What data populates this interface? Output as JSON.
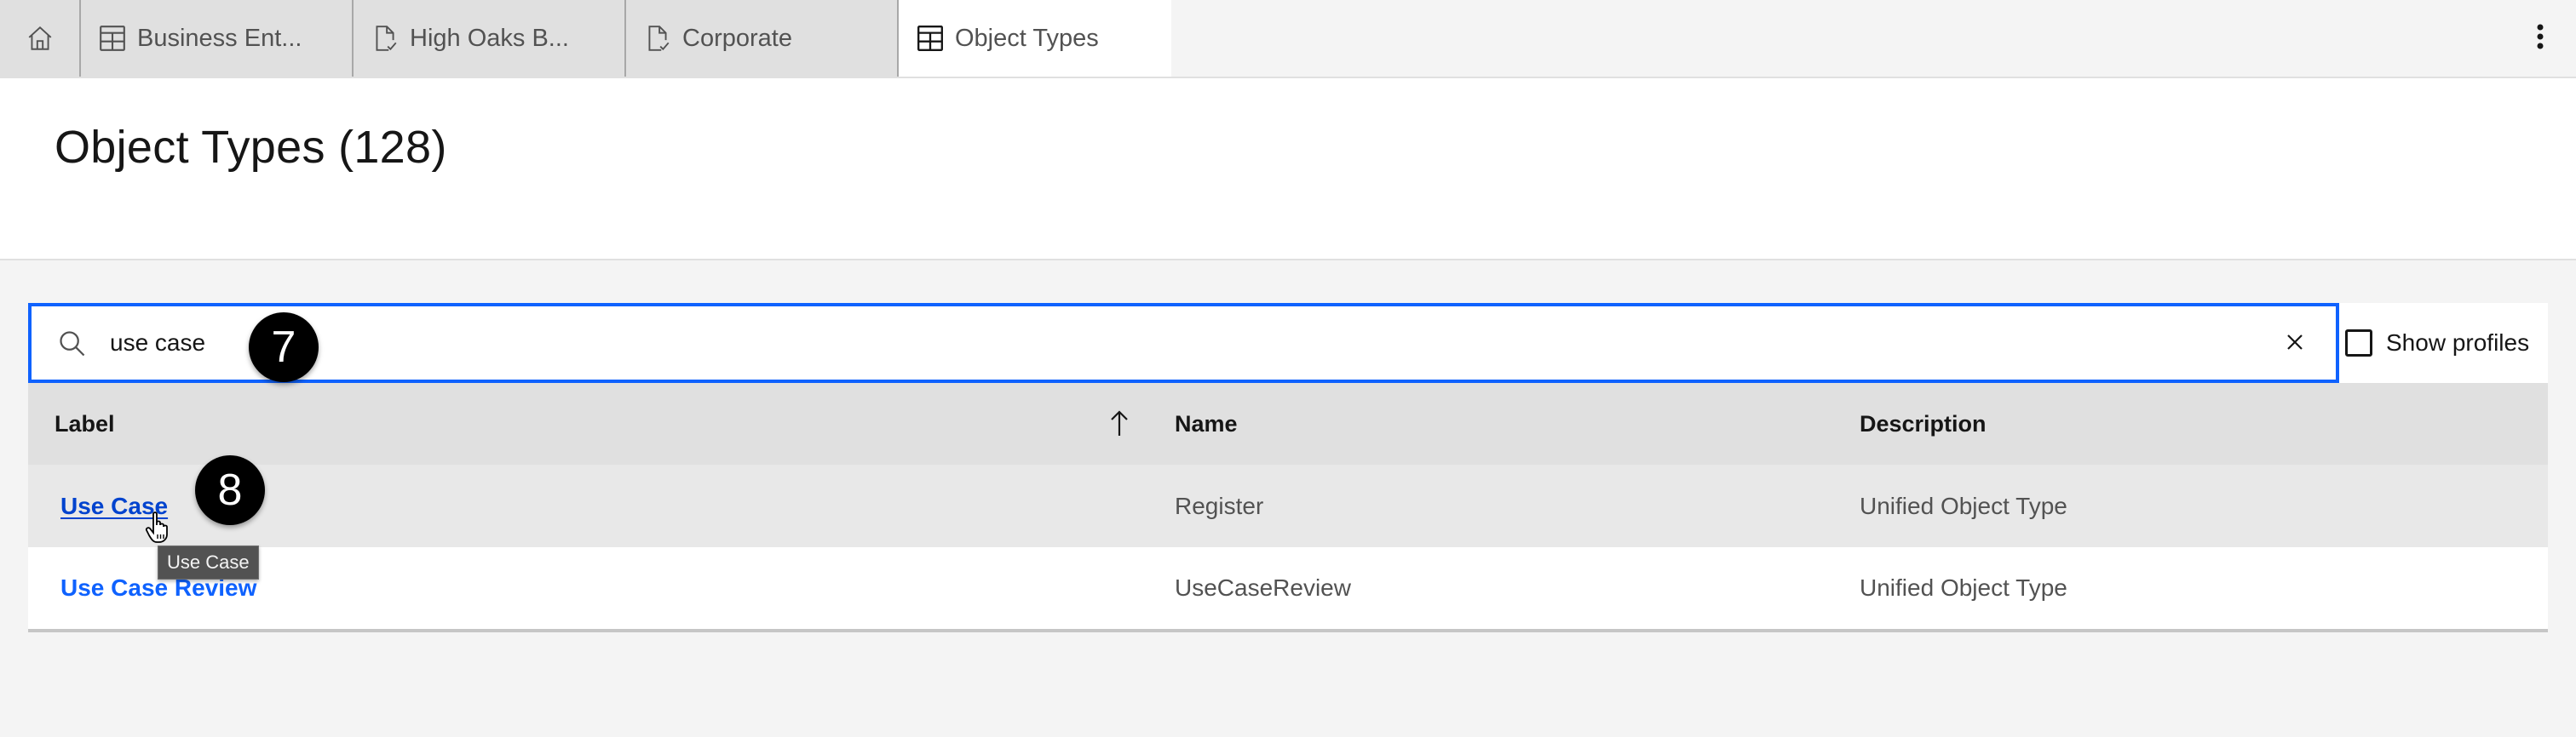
{
  "tabs": [
    {
      "id": "home",
      "icon": "home-icon",
      "label": ""
    },
    {
      "id": "business-entities",
      "icon": "table-icon",
      "label": "Business Ent..."
    },
    {
      "id": "high-oaks",
      "icon": "document-check-icon",
      "label": "High Oaks B..."
    },
    {
      "id": "corporate",
      "icon": "document-check-icon",
      "label": "Corporate"
    },
    {
      "id": "object-types",
      "icon": "table-icon",
      "label": "Object Types",
      "active": true
    }
  ],
  "overflow_menu_icon": "overflow-menu-vertical-icon",
  "page": {
    "title": "Object Types (128)"
  },
  "search": {
    "value": "use case",
    "placeholder": "",
    "icon": "search-icon",
    "clear_icon": "close-icon"
  },
  "show_profiles": {
    "label": "Show profiles",
    "checked": false
  },
  "table": {
    "columns": [
      {
        "key": "label",
        "label": "Label",
        "sorted": "ascending"
      },
      {
        "key": "name",
        "label": "Name"
      },
      {
        "key": "description",
        "label": "Description"
      }
    ],
    "rows": [
      {
        "label": "Use Case",
        "name": "Register",
        "description": "Unified Object Type",
        "hovered": true
      },
      {
        "label": "Use Case Review",
        "name": "UseCaseReview",
        "description": "Unified Object Type"
      }
    ]
  },
  "annotations": {
    "step_7": "7",
    "step_8": "8"
  },
  "tooltip": {
    "text": "Use Case"
  },
  "colors": {
    "accent": "#0f62fe",
    "link": "#0f62fe",
    "link_hover": "#0043ce",
    "tab_bg": "#e0e0e0",
    "header_row_bg": "#e0e0e0",
    "hover_row_bg": "#e8e8e8",
    "page_bg": "#f4f4f4"
  }
}
